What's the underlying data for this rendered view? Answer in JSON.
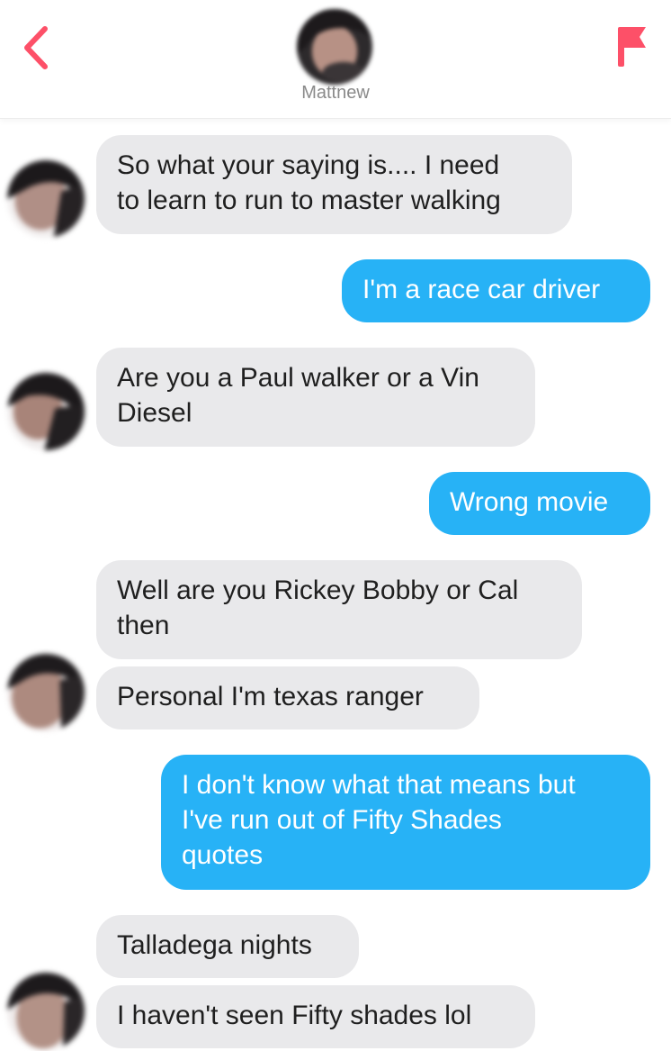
{
  "header": {
    "contact_name": "Mattnew",
    "back_icon": "chevron-left-icon",
    "report_icon": "flag-icon",
    "accent_color": "#fd5068"
  },
  "colors": {
    "incoming_bubble": "#e9e9eb",
    "outgoing_bubble": "#27b2f6"
  },
  "messages": [
    {
      "sender": "them",
      "lines": [
        "So what your saying is.... I need",
        "to learn to run to master walking"
      ]
    },
    {
      "sender": "me",
      "lines": [
        "I'm a race car driver"
      ]
    },
    {
      "sender": "them",
      "lines": [
        "Are you a Paul walker or a Vin",
        "Diesel"
      ]
    },
    {
      "sender": "me",
      "lines": [
        "Wrong movie"
      ]
    },
    {
      "sender": "them",
      "lines": [
        "Well are you Rickey Bobby or Cal",
        "then"
      ]
    },
    {
      "sender": "them",
      "lines": [
        "Personal I'm texas ranger"
      ]
    },
    {
      "sender": "me",
      "lines": [
        "I don't know what that means but",
        "I've run out of Fifty Shades",
        "quotes"
      ]
    },
    {
      "sender": "them",
      "lines": [
        "Talladega nights"
      ]
    },
    {
      "sender": "them",
      "lines": [
        "I haven't seen Fifty shades lol"
      ]
    }
  ]
}
